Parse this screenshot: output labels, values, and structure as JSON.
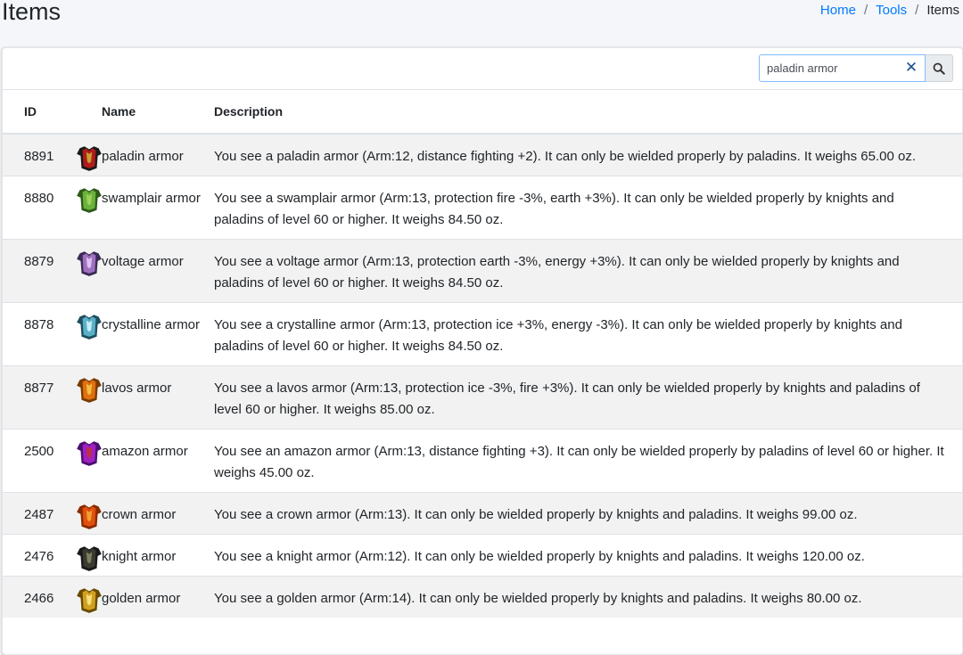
{
  "page_title": "Items",
  "breadcrumb": [
    {
      "label": "Home"
    },
    {
      "label": "Tools"
    },
    {
      "label": "Items"
    }
  ],
  "search": {
    "value": "paladin armor",
    "clear_icon": "close-icon",
    "button_icon": "search-icon"
  },
  "table": {
    "headers": {
      "id": "ID",
      "name": "Name",
      "description": "Description"
    },
    "rows": [
      {
        "id": "8891",
        "name": "paladin armor",
        "icon": "paladin-armor-icon",
        "description": "You see a paladin armor (Arm:12, distance fighting +2). It can only be wielded properly by paladins. It weighs 65.00 oz."
      },
      {
        "id": "8880",
        "name": "swamplair armor",
        "icon": "swamplair-armor-icon",
        "description": "You see a swamplair armor (Arm:13, protection fire -3%, earth +3%). It can only be wielded properly by knights and paladins of level 60 or higher. It weighs 84.50 oz."
      },
      {
        "id": "8879",
        "name": "voltage armor",
        "icon": "voltage-armor-icon",
        "description": "You see a voltage armor (Arm:13, protection earth -3%, energy +3%). It can only be wielded properly by knights and paladins of level 60 or higher. It weighs 84.50 oz."
      },
      {
        "id": "8878",
        "name": "crystalline armor",
        "icon": "crystalline-armor-icon",
        "description": "You see a crystalline armor (Arm:13, protection ice +3%, energy -3%). It can only be wielded properly by knights and paladins of level 60 or higher. It weighs 84.50 oz."
      },
      {
        "id": "8877",
        "name": "lavos armor",
        "icon": "lavos-armor-icon",
        "description": "You see a lavos armor (Arm:13, protection ice -3%, fire +3%). It can only be wielded properly by knights and paladins of level 60 or higher. It weighs 85.00 oz."
      },
      {
        "id": "2500",
        "name": "amazon armor",
        "icon": "amazon-armor-icon",
        "description": "You see an amazon armor (Arm:13, distance fighting +3). It can only be wielded properly by paladins of level 60 or higher. It weighs 45.00 oz."
      },
      {
        "id": "2487",
        "name": "crown armor",
        "icon": "crown-armor-icon",
        "description": "You see a crown armor (Arm:13). It can only be wielded properly by knights and paladins. It weighs 99.00 oz."
      },
      {
        "id": "2476",
        "name": "knight armor",
        "icon": "knight-armor-icon",
        "description": "You see a knight armor (Arm:12). It can only be wielded properly by knights and paladins. It weighs 120.00 oz."
      },
      {
        "id": "2466",
        "name": "golden armor",
        "icon": "golden-armor-icon",
        "description": "You see a golden armor (Arm:14). It can only be wielded properly by knights and paladins. It weighs 80.00 oz."
      }
    ]
  }
}
